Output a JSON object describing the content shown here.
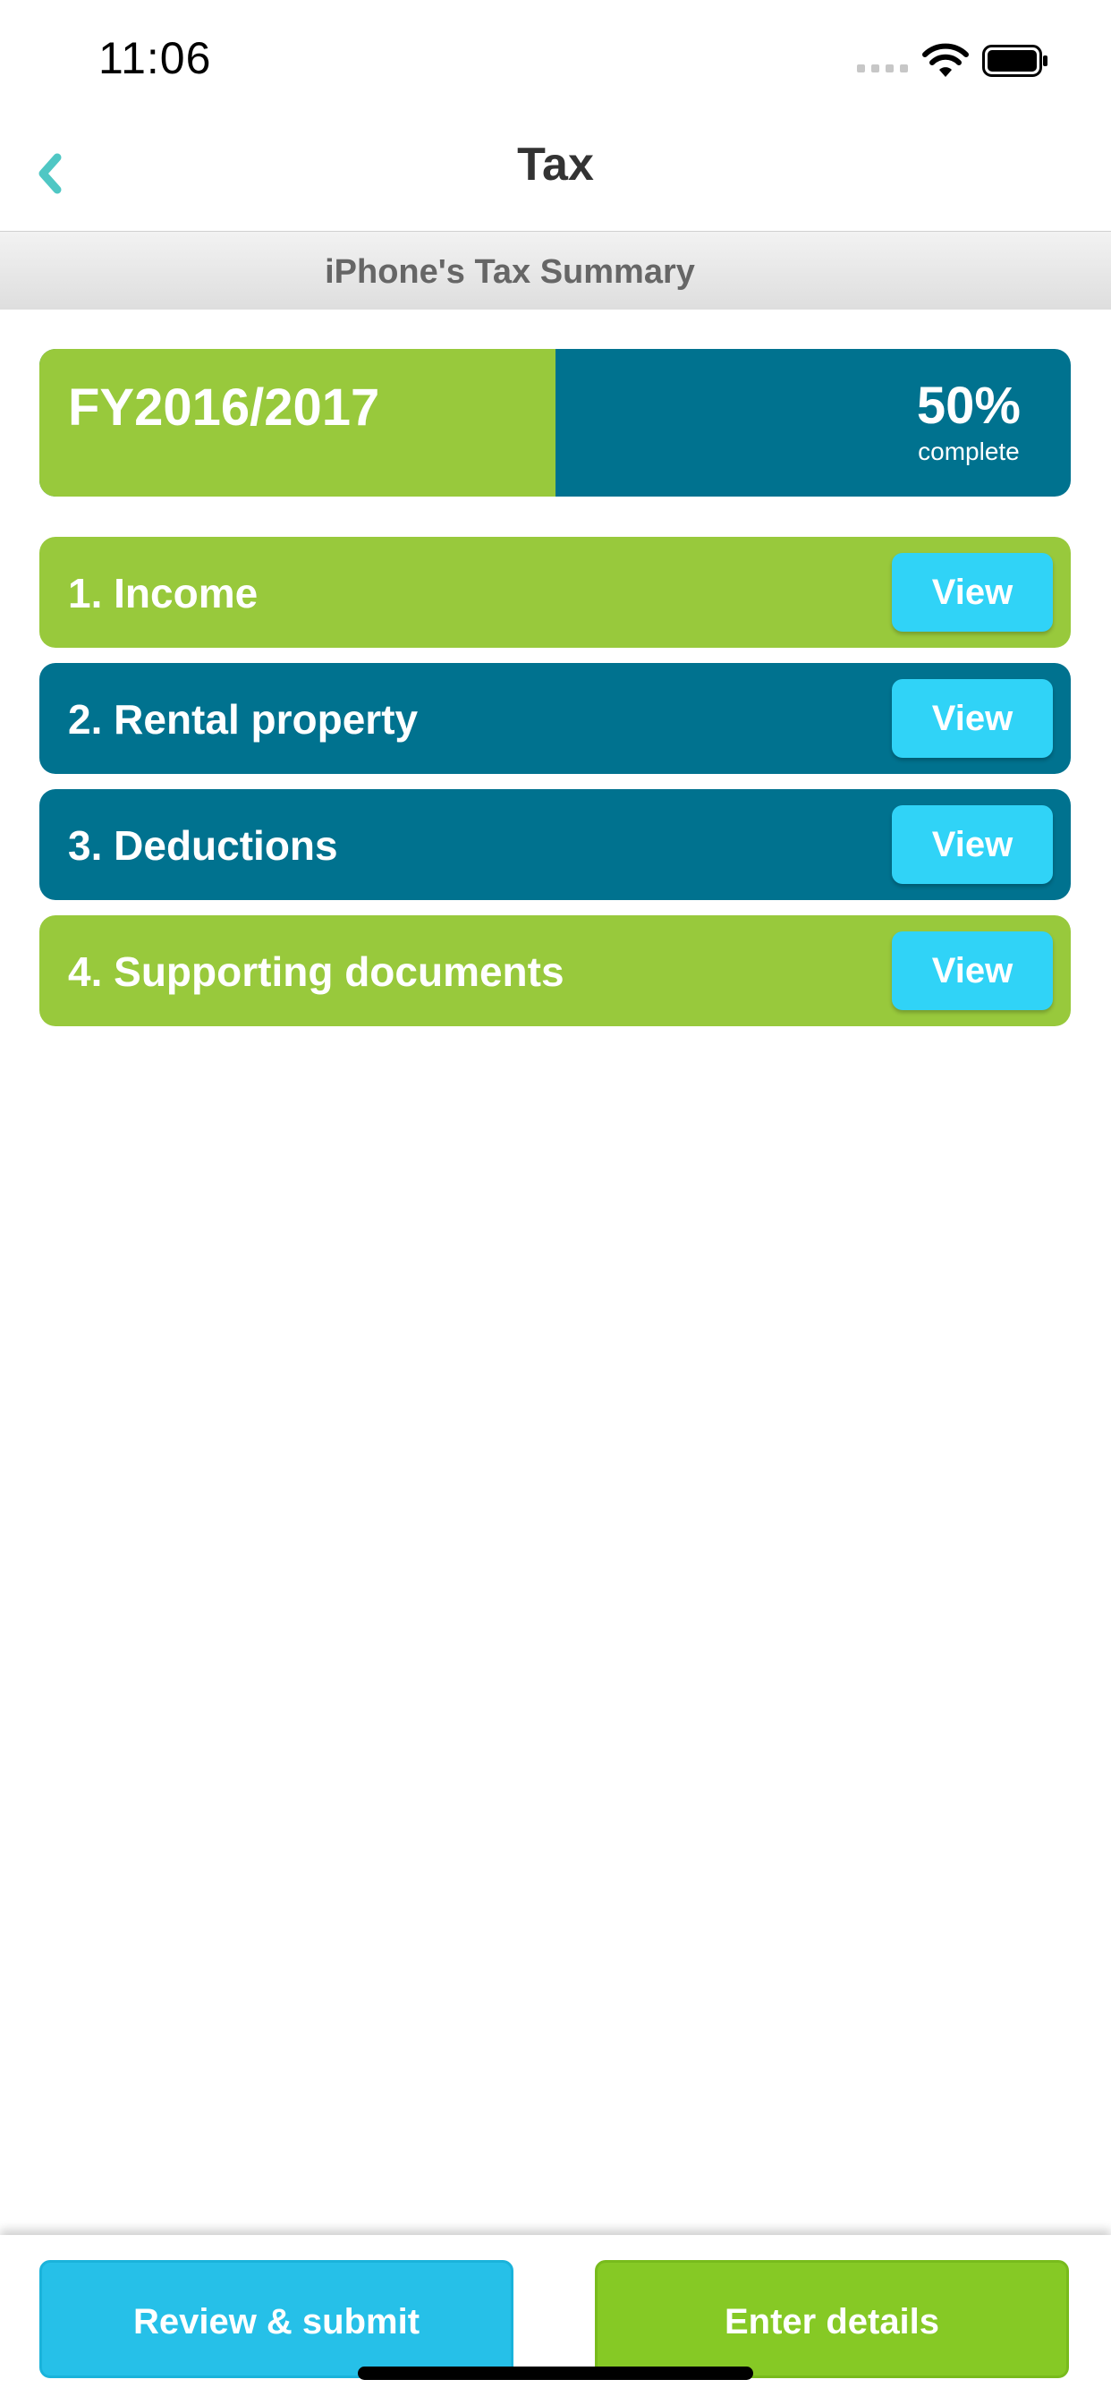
{
  "status_bar": {
    "time": "11:06"
  },
  "nav": {
    "title": "Tax",
    "back_icon": "chevron-left-icon"
  },
  "summary_header": "iPhone's Tax Summary",
  "year_card": {
    "label": "FY2016/2017",
    "percent_text": "50%",
    "percent_sub": "complete",
    "progress": 0.5
  },
  "sections": [
    {
      "label": "1. Income",
      "button": "View",
      "color": "#98c93c"
    },
    {
      "label": "2. Rental property",
      "button": "View",
      "color": "#00728f"
    },
    {
      "label": "3. Deductions",
      "button": "View",
      "color": "#00728f"
    },
    {
      "label": "4. Supporting documents",
      "button": "View",
      "color": "#98c93c"
    }
  ],
  "bottom": {
    "review_label": "Review & submit",
    "enter_label": "Enter details"
  },
  "colors": {
    "green": "#98c93c",
    "teal": "#00728f",
    "cyan": "#30d3f7",
    "back": "#4fc7c4"
  }
}
